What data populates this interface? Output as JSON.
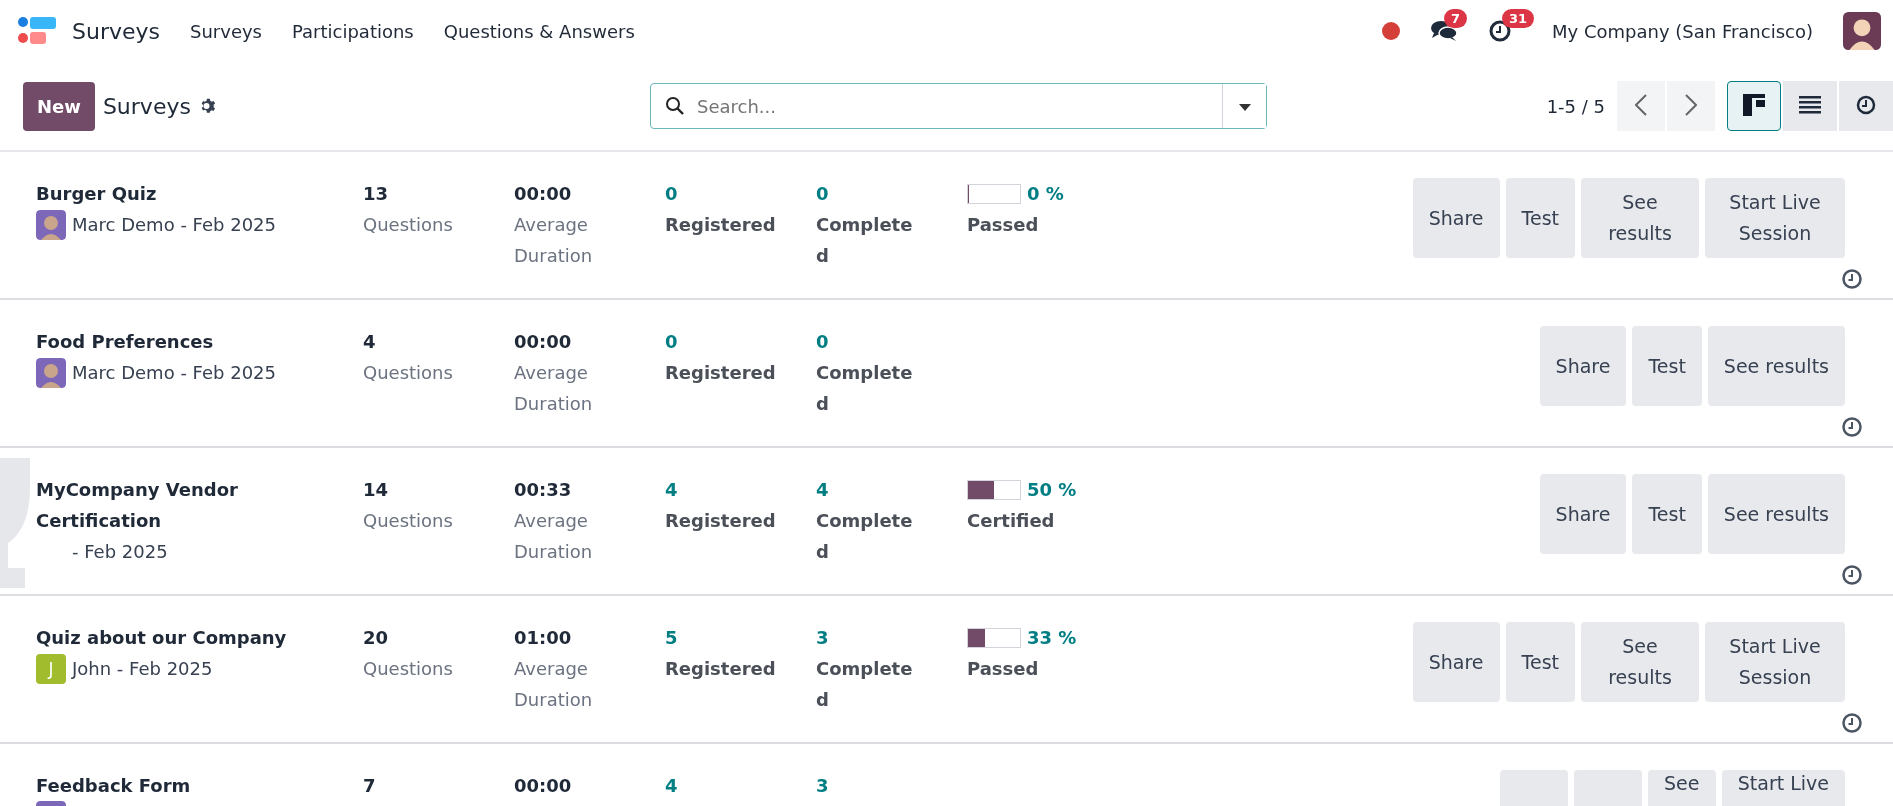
{
  "app": {
    "name": "Surveys"
  },
  "menu": [
    {
      "label": "Surveys"
    },
    {
      "label": "Participations"
    },
    {
      "label": "Questions & Answers"
    }
  ],
  "systray": {
    "chat_count": "7",
    "activity_count": "31",
    "company": "My Company (San Francisco)"
  },
  "control_panel": {
    "new_button": "New",
    "breadcrumb": "Surveys",
    "search": {
      "placeholder": "Search..."
    },
    "pager": "1-5 / 5",
    "views": [
      {
        "kind": "kanban",
        "selected": true
      },
      {
        "kind": "list",
        "selected": false
      },
      {
        "kind": "activity",
        "selected": false
      }
    ]
  },
  "surveys": [
    {
      "title": "Burger Quiz",
      "trophy_art": false,
      "avatar": {
        "kind": "photo"
      },
      "owner": "Marc Demo - Feb 2025",
      "questions": "13",
      "questions_label": "Questions",
      "duration": "00:00",
      "duration_label": "Average Duration",
      "registered": "0",
      "registered_label": "Registered",
      "completed": "0",
      "completed_label": "Completed",
      "progress": {
        "level": 0,
        "reading": "0 %",
        "label": "Passed"
      },
      "buttons": [
        {
          "label": "Share"
        },
        {
          "label": "Test"
        },
        {
          "label": "See results"
        },
        {
          "label": "Start Live Session"
        }
      ]
    },
    {
      "title": "Food Preferences",
      "trophy_art": false,
      "avatar": {
        "kind": "photo"
      },
      "owner": "Marc Demo - Feb 2025",
      "questions": "4",
      "questions_label": "Questions",
      "duration": "00:00",
      "duration_label": "Average Duration",
      "registered": "0",
      "registered_label": "Registered",
      "completed": "0",
      "completed_label": "Completed",
      "buttons": [
        {
          "label": "Share"
        },
        {
          "label": "Test"
        },
        {
          "label": "See results"
        }
      ]
    },
    {
      "title": "MyCompany Vendor Certification",
      "trophy_art": true,
      "avatar": {
        "kind": "blank"
      },
      "owner": "- Feb 2025",
      "questions": "14",
      "questions_label": "Questions",
      "duration": "00:33",
      "duration_label": "Average Duration",
      "registered": "4",
      "registered_label": "Registered",
      "completed": "4",
      "completed_label": "Completed",
      "progress": {
        "level": 0.5,
        "reading": "50 %",
        "label": "Certified"
      },
      "buttons": [
        {
          "label": "Share"
        },
        {
          "label": "Test"
        },
        {
          "label": "See results"
        }
      ]
    },
    {
      "title": "Quiz about our Company",
      "trophy_art": false,
      "avatar": {
        "kind": "letter",
        "text": "J"
      },
      "owner": "John - Feb 2025",
      "questions": "20",
      "questions_label": "Questions",
      "duration": "01:00",
      "duration_label": "Average Duration",
      "registered": "5",
      "registered_label": "Registered",
      "completed": "3",
      "completed_label": "Completed",
      "progress": {
        "level": 0.33,
        "reading": "33 %",
        "label": "Passed"
      },
      "buttons": [
        {
          "label": "Share"
        },
        {
          "label": "Test"
        },
        {
          "label": "See results"
        },
        {
          "label": "Start Live Session"
        }
      ]
    },
    {
      "title": "Feedback Form",
      "trophy_art": false,
      "avatar": {
        "kind": "photo"
      },
      "questions": "7",
      "duration": "00:00",
      "registered": "4",
      "completed": "3",
      "buttons": [
        {
          "kind": "blank"
        },
        {
          "kind": "blank"
        },
        {
          "kind": "text",
          "label": "See"
        },
        {
          "kind": "text",
          "label": "Start Live"
        }
      ]
    }
  ]
}
